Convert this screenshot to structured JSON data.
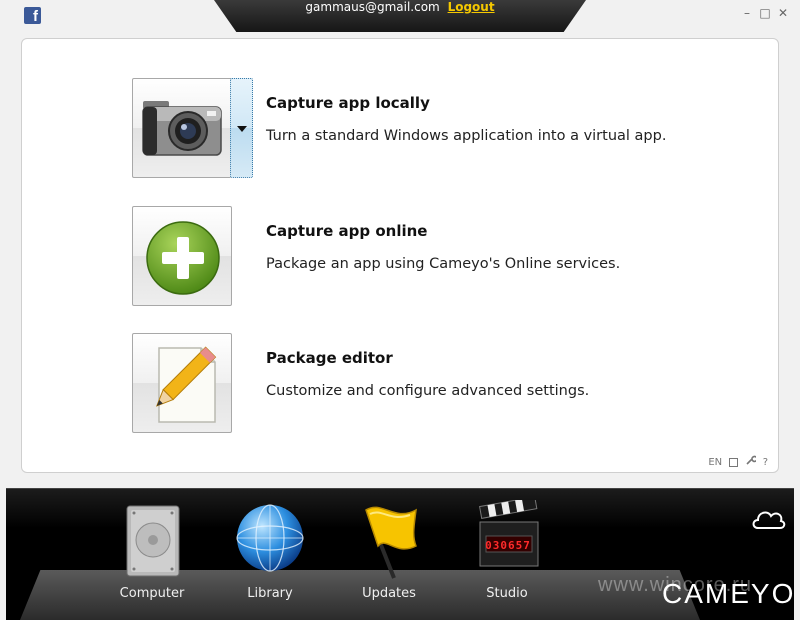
{
  "header": {
    "email": "gammaus@gmail.com",
    "logout_label": "Logout",
    "facebook_glyph": "f"
  },
  "window_controls": {
    "minimize": "–",
    "maximize": "□",
    "close": "✕"
  },
  "actions": [
    {
      "title": "Capture app locally",
      "description": "Turn a standard Windows application into a virtual app.",
      "icon": "camera-icon",
      "has_dropdown": true
    },
    {
      "title": "Capture app online",
      "description": "Package an app using Cameyo's Online services.",
      "icon": "plus-circle-icon",
      "has_dropdown": false
    },
    {
      "title": "Package editor",
      "description": "Customize and configure advanced settings.",
      "icon": "document-pencil-icon",
      "has_dropdown": false
    }
  ],
  "footer": {
    "language": "EN",
    "help": "?"
  },
  "dock": {
    "items": [
      {
        "label": "Computer",
        "icon": "hard-drive-icon"
      },
      {
        "label": "Library",
        "icon": "globe-icon"
      },
      {
        "label": "Updates",
        "icon": "flag-icon"
      },
      {
        "label": "Studio",
        "icon": "clapperboard-icon",
        "counter": "030657"
      }
    ],
    "brand": "CAMEYO",
    "watermark": "www.wincore.ru"
  },
  "colors": {
    "accent_yellow": "#f5c800",
    "dock_background": "#000000",
    "facebook_blue": "#3b5998",
    "plus_green": "#6aa22a"
  }
}
